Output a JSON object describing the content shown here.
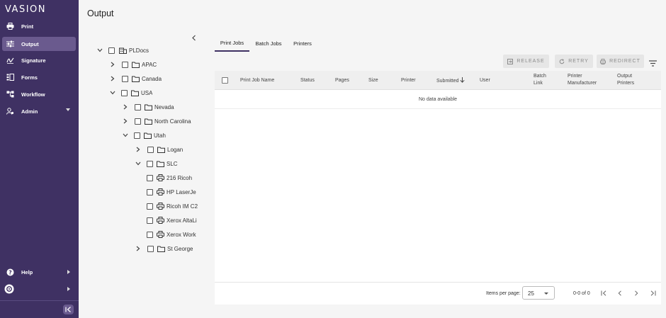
{
  "brand": {
    "logo_text": "VASION"
  },
  "sidebar": {
    "items": [
      {
        "label": "Print",
        "icon": "printer-icon"
      },
      {
        "label": "Output",
        "icon": "sliders-icon"
      },
      {
        "label": "Signature",
        "icon": "signature-icon"
      },
      {
        "label": "Forms",
        "icon": "forms-icon"
      },
      {
        "label": "Workflow",
        "icon": "workflow-icon"
      },
      {
        "label": "Admin",
        "icon": "admin-icon"
      }
    ],
    "bottom": [
      {
        "label": "Help",
        "icon": "help-icon"
      },
      {
        "label": "",
        "icon": "user-avatar-icon"
      }
    ]
  },
  "page": {
    "title": "Output"
  },
  "tree": {
    "nodes": [
      {
        "label": "PLDocs",
        "type": "building"
      },
      {
        "label": "APAC",
        "type": "folder"
      },
      {
        "label": "Canada",
        "type": "folder"
      },
      {
        "label": "USA",
        "type": "folder"
      },
      {
        "label": "Nevada",
        "type": "folder"
      },
      {
        "label": "North Carolina",
        "type": "folder"
      },
      {
        "label": "Utah",
        "type": "folder"
      },
      {
        "label": "Logan",
        "type": "folder"
      },
      {
        "label": "SLC",
        "type": "folder"
      },
      {
        "label": "216 Ricoh",
        "type": "printer"
      },
      {
        "label": "HP LaserJe",
        "type": "printer"
      },
      {
        "label": "Ricoh IM C2",
        "type": "printer"
      },
      {
        "label": "Xerox AltaLi",
        "type": "printer"
      },
      {
        "label": "Xerox Work",
        "type": "printer"
      },
      {
        "label": "St George",
        "type": "folder"
      }
    ]
  },
  "tabs": [
    {
      "label": "Print Jobs"
    },
    {
      "label": "Batch Jobs"
    },
    {
      "label": "Printers"
    }
  ],
  "toolbar": {
    "release_label": "RELEASE",
    "retry_label": "RETRY",
    "redirect_label": "REDIRECT"
  },
  "grid": {
    "columns": [
      {
        "label": "Print Job Name"
      },
      {
        "label": "Status"
      },
      {
        "label": "Pages"
      },
      {
        "label": "Size"
      },
      {
        "label": "Printer"
      },
      {
        "label": "Submitted"
      },
      {
        "label": "User"
      },
      {
        "line1": "Batch",
        "line2": "Link"
      },
      {
        "line1": "Printer",
        "line2": "Manufacturer"
      },
      {
        "line1": "Output",
        "line2": "Printers"
      }
    ],
    "empty_message": "No data available"
  },
  "pagination": {
    "items_per_page_label": "Items per page:",
    "items_per_page_value": "25",
    "range_label": "0-0 of 0"
  },
  "colors": {
    "sidebar_bg": "#3f3163",
    "sidebar_active": "#6a5a8e",
    "accent": "#3f3163"
  }
}
